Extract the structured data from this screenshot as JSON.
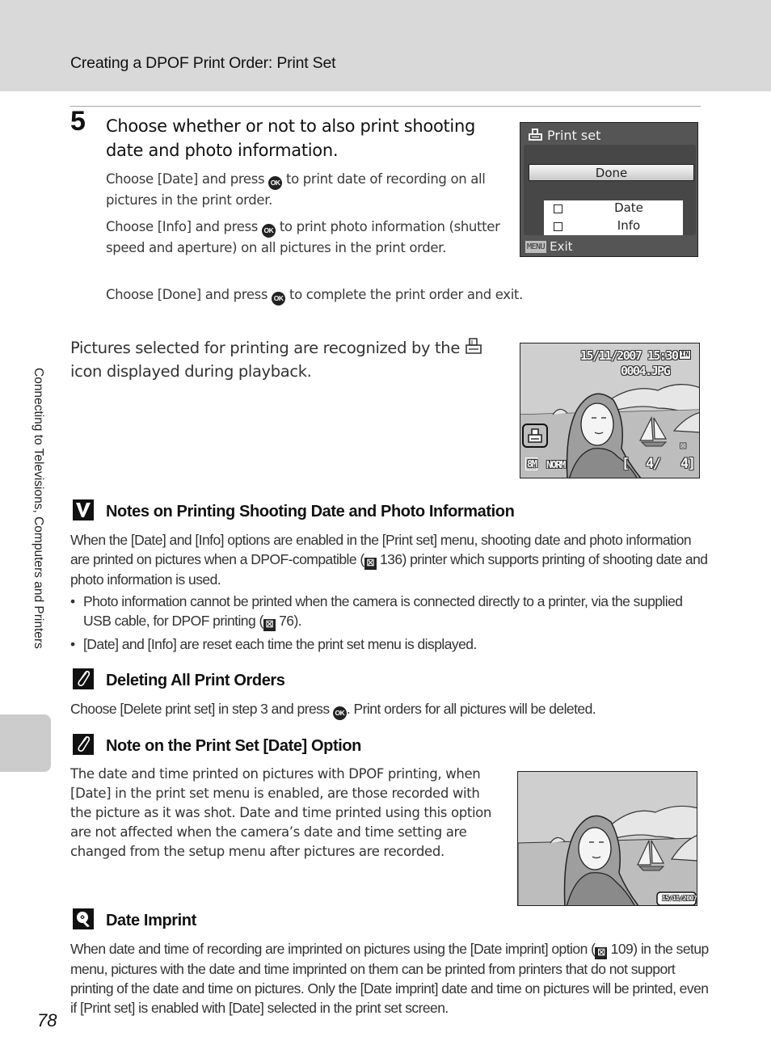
{
  "header": {
    "title": "Creating a DPOF Print Order: Print Set"
  },
  "side_tab": {
    "label": "Connecting to Televisions, Computers and Printers"
  },
  "step": {
    "number": "5",
    "heading": "Choose whether or not to also print shooting date and photo information.",
    "paragraphs": [
      {
        "before": "Choose [Date] and press",
        "icon": "ok-button-icon",
        "after": "to print date of recording on all pictures in the print order."
      },
      {
        "before": "Choose [Info] and press",
        "icon": "ok-button-icon",
        "after": "to print photo information (shutter speed and aperture) on all pictures in the print order."
      },
      {
        "before": "Choose [Done] and press",
        "icon": "ok-button-icon",
        "after": "to complete the print order and exit."
      }
    ],
    "ok_label": "OK"
  },
  "camera_menu": {
    "title": "Print set",
    "title_icon": "print-icon",
    "done_label": "Done",
    "options": [
      {
        "label": "Date",
        "checked": false
      },
      {
        "label": "Info",
        "checked": false
      }
    ],
    "footer_badge": "MENU",
    "footer_label": "Exit"
  },
  "recognition_text": {
    "before": "Pictures selected for printing are recognized by the",
    "icon": "print-icon",
    "after": "icon displayed during playback."
  },
  "playback_screen": {
    "datetime": "15/11/2007 15:30",
    "filename": "0004.JPG",
    "memory_badge": "IN",
    "image_mode": "8M",
    "quality": "NORM",
    "frame_counter_open": "[",
    "frame_current": "4/",
    "frame_total": "4]",
    "print_mark_icon": "print-icon",
    "no_audio_icon": "no-voice-memo-icon"
  },
  "notes_section": {
    "icon": "check-mark-icon",
    "title": "Notes on Printing Shooting Date and Photo Information",
    "body": {
      "before": "When the [Date] and [Info] options are enabled in the [Print set] menu, shooting date and photo information are printed on pictures when a DPOF-compatible (",
      "ref_page": "136",
      "after": ") printer which supports printing of shooting date and photo information is used."
    },
    "bullets": [
      {
        "before": "Photo information cannot be printed when the camera is connected directly to a printer, via the supplied USB cable, for DPOF printing (",
        "ref_page": "76",
        "after": ")."
      },
      {
        "text": "[Date] and [Info] are reset each time the print set menu is displayed."
      }
    ]
  },
  "deleting_section": {
    "icon": "paperclip-icon",
    "title": "Deleting All Print Orders",
    "body_before": "Choose [Delete print set] in step 3 and press",
    "body_after": ". Print orders for all pictures will be deleted."
  },
  "date_option_section": {
    "icon": "paperclip-icon",
    "title": "Note on the Print Set [Date] Option",
    "body": "The date and time printed on pictures with DPOF printing, when [Date] in the print set menu is enabled, are those recorded with the picture as it was shot. Date and time printed using this option are not affected when the camera’s date and time setting are changed from the setup menu after pictures are recorded.",
    "print_sample_date": "15/11/2007"
  },
  "date_imprint_section": {
    "icon": "tip-lightbulb-icon",
    "title": "Date Imprint",
    "body_before": "When date and time of recording are imprinted on pictures using the [Date imprint] option (",
    "ref_page": "109",
    "body_after": ") in the setup menu, pictures with the date and time imprinted on them can be printed from printers that do not support printing of the date and time on pictures. Only the [Date imprint] date and time on pictures will be printed, even if [Print set] is enabled with [Date] selected in the print set screen."
  },
  "ref_icon_glyph": "☒",
  "page_number": "78"
}
